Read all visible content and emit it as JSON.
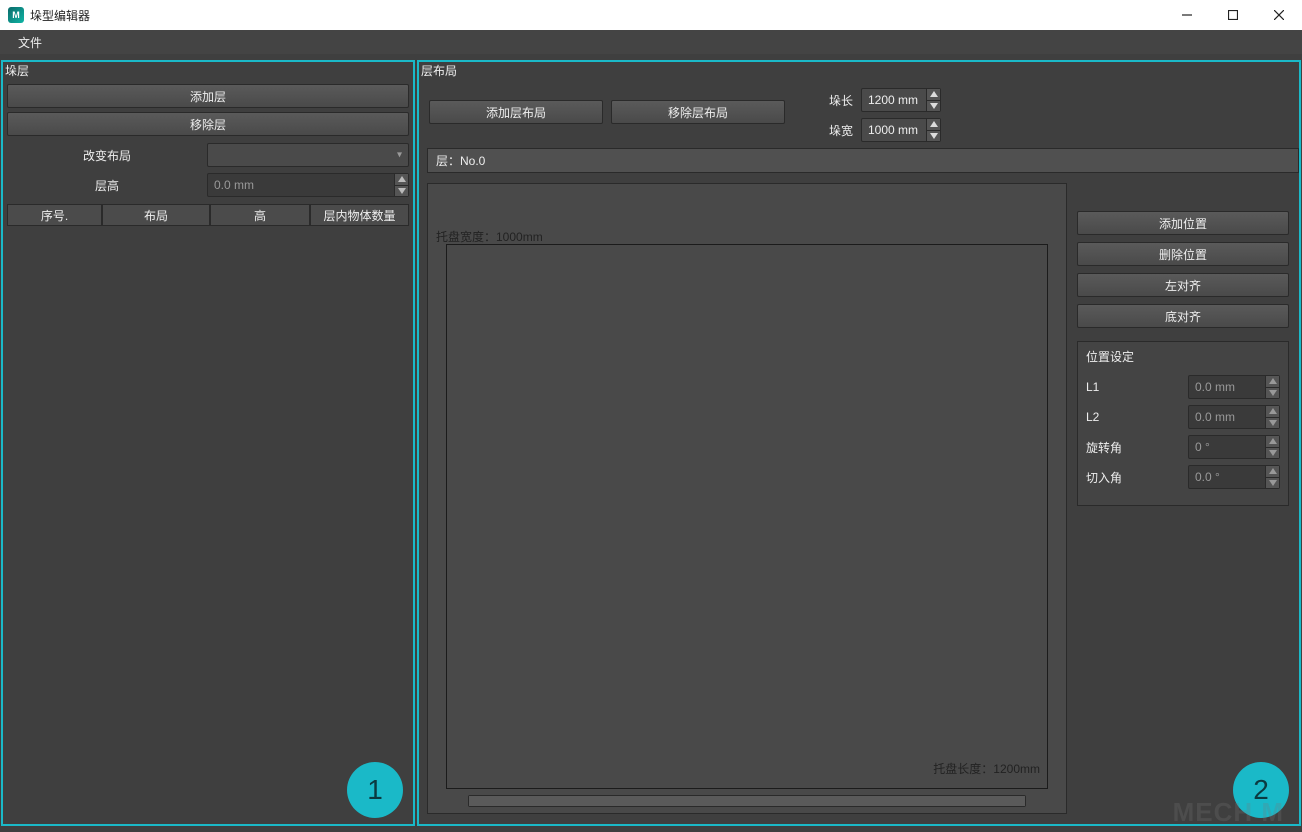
{
  "window": {
    "title": "垛型编辑器"
  },
  "menu": {
    "file": "文件"
  },
  "left_panel": {
    "title": "垛层",
    "add_layer": "添加层",
    "remove_layer": "移除层",
    "change_layout_label": "改变布局",
    "layer_height_label": "层高",
    "layer_height_value": "0.0 mm",
    "table_headers": {
      "seq": "序号.",
      "layout": "布局",
      "height": "高",
      "count": "层内物体数量"
    },
    "badge": "1"
  },
  "right_panel": {
    "title": "层布局",
    "add_layout": "添加层布局",
    "remove_layout": "移除层布局",
    "pallet_length_label": "垛长",
    "pallet_length_value": "1200 mm",
    "pallet_width_label": "垛宽",
    "pallet_width_value": "1000 mm",
    "layer_tag": "层：No.0",
    "canvas": {
      "width_label": "托盘宽度：1000mm",
      "length_label": "托盘长度：1200mm"
    },
    "buttons": {
      "add_position": "添加位置",
      "delete_position": "删除位置",
      "align_left": "左对齐",
      "align_bottom": "底对齐"
    },
    "position_settings": {
      "title": "位置设定",
      "l1_label": "L1",
      "l1_value": "0.0 mm",
      "l2_label": "L2",
      "l2_value": "0.0 mm",
      "rotation_label": "旋转角",
      "rotation_value": "0 °",
      "cutin_label": "切入角",
      "cutin_value": "0.0 °"
    },
    "badge": "2"
  },
  "watermark": "MECH  M"
}
